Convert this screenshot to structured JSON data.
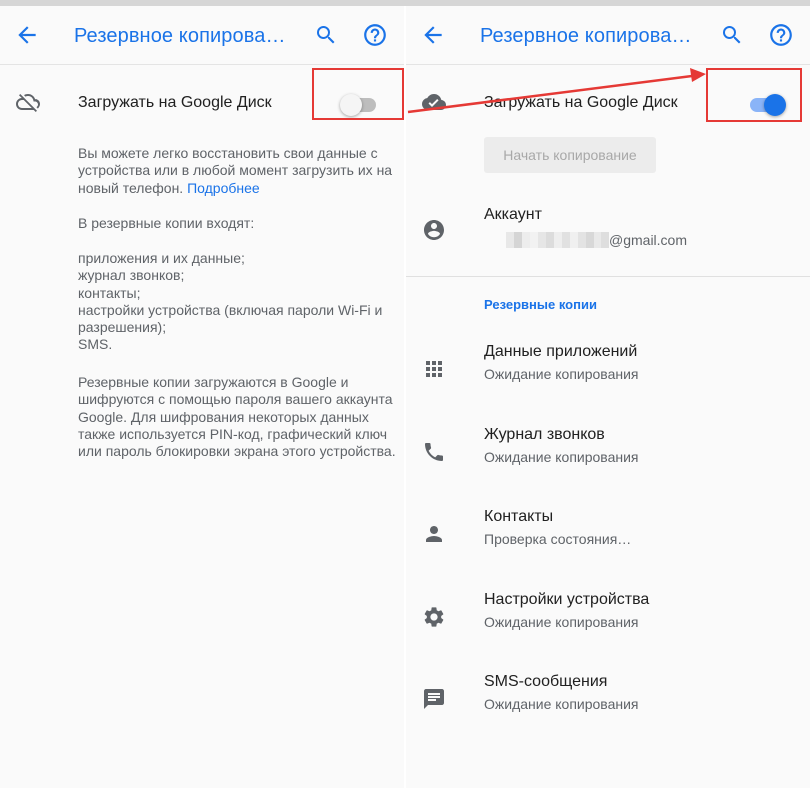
{
  "header": {
    "title": "Резервное копирова…",
    "back_icon": "arrow-back-icon",
    "search_icon": "search-icon",
    "help_icon": "help-circle-icon"
  },
  "backup_toggle": {
    "label": "Загружать на Google Диск",
    "off_state": false,
    "on_state": true
  },
  "left": {
    "description_p1": "Вы можете легко восстановить свои данные с устройства или в любой момент загрузить их на новый телефон.",
    "more_link": "Подробнее",
    "includes_intro": "В резервные копии входят:",
    "includes_list": [
      "приложения и их данные;",
      "журнал звонков;",
      "контакты;",
      "настройки устройства (включая пароли Wi-Fi и разрешения);",
      "SMS."
    ],
    "description_p2": "Резервные копии загружаются в Google и шифруются с помощью пароля вашего аккаунта Google. Для шифрования некоторых данных также используется PIN-код, графический ключ или пароль блокировки экрана этого устройства."
  },
  "right": {
    "start_button": "Начать копирование",
    "account": {
      "title": "Аккаунт",
      "email_suffix": "@gmail.com"
    },
    "section_title": "Резервные копии",
    "items": [
      {
        "title": "Данные приложений",
        "status": "Ожидание копирования",
        "icon": "apps-grid-icon"
      },
      {
        "title": "Журнал звонков",
        "status": "Ожидание копирования",
        "icon": "phone-icon"
      },
      {
        "title": "Контакты",
        "status": "Проверка состояния…",
        "icon": "person-icon"
      },
      {
        "title": "Настройки устройства",
        "status": "Ожидание копирования",
        "icon": "gear-icon"
      },
      {
        "title": "SMS-сообщения",
        "status": "Ожидание копирования",
        "icon": "message-icon"
      }
    ]
  },
  "colors": {
    "accent": "#1a73e8",
    "highlight": "#e53935",
    "switch_off_track": "#bdbdbd",
    "switch_off_knob": "#f5f5f5",
    "switch_on_track": "#8ab4f8",
    "switch_on_knob": "#1a73e8"
  }
}
